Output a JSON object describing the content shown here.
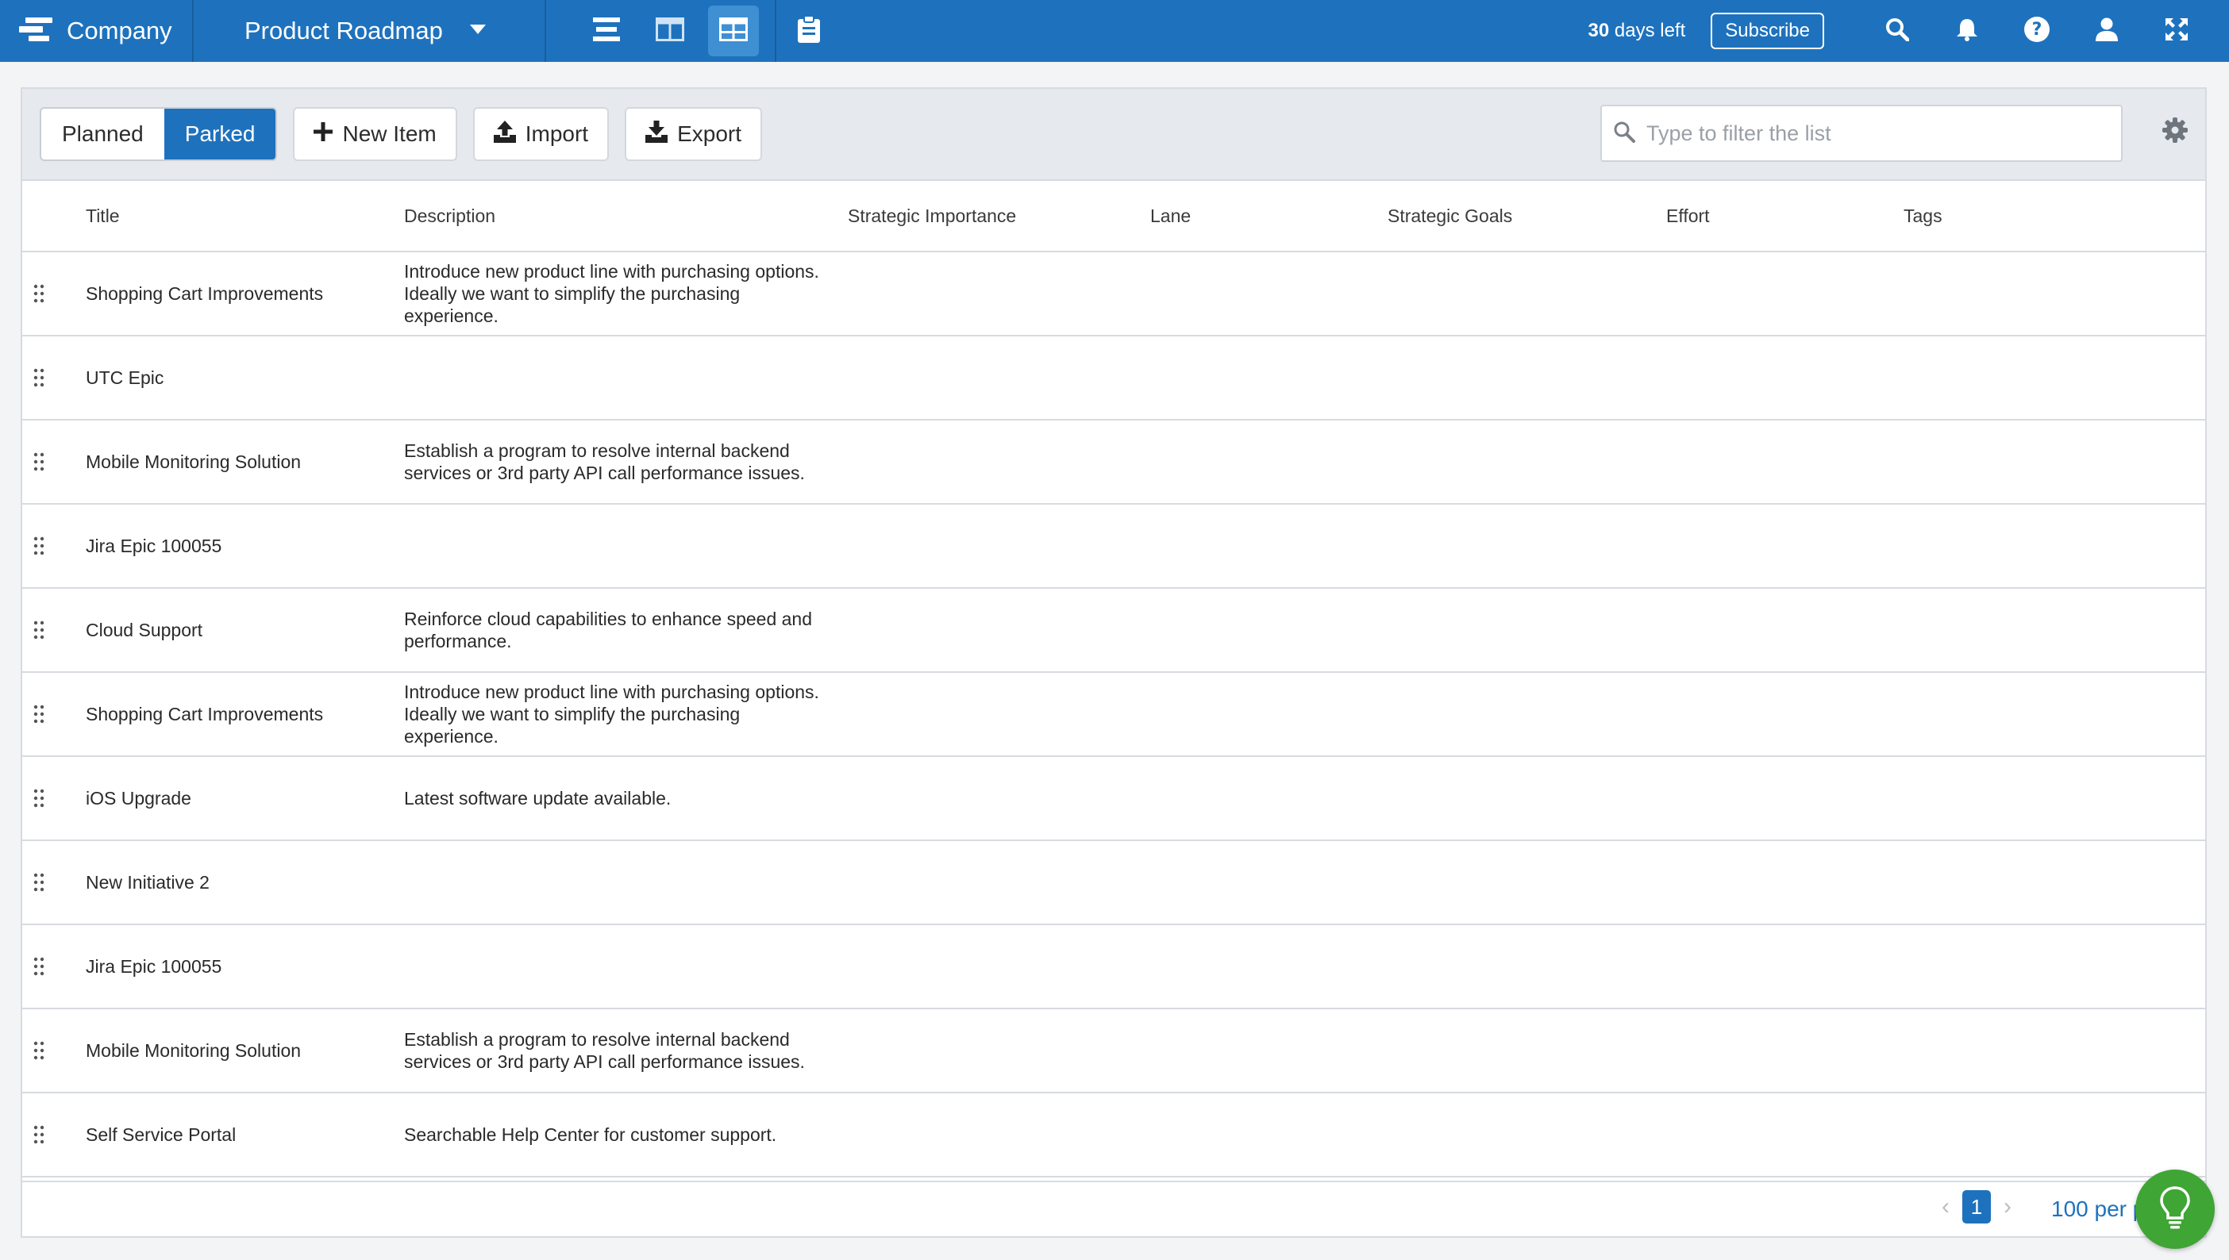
{
  "topbar": {
    "company": "Company",
    "roadmap": "Product Roadmap",
    "days_number": "30",
    "days_text": " days left",
    "subscribe": "Subscribe"
  },
  "toolbar": {
    "planned": "Planned",
    "parked": "Parked",
    "new_item": "New Item",
    "import": "Import",
    "export": "Export",
    "filter_placeholder": "Type to filter the list"
  },
  "table": {
    "headers": {
      "title": "Title",
      "description": "Description",
      "strategic_importance": "Strategic Importance",
      "lane": "Lane",
      "strategic_goals": "Strategic Goals",
      "effort": "Effort",
      "tags": "Tags"
    },
    "rows": [
      {
        "title": "Shopping Cart Improvements",
        "description": "Introduce new product line with purchasing options. Ideally we want to simplify the purchasing experience."
      },
      {
        "title": "UTC Epic",
        "description": ""
      },
      {
        "title": "Mobile Monitoring Solution",
        "description": "Establish a program to resolve internal backend services or 3rd party API call performance issues."
      },
      {
        "title": "Jira Epic 100055",
        "description": ""
      },
      {
        "title": "Cloud Support",
        "description": "Reinforce cloud capabilities to enhance speed and performance."
      },
      {
        "title": "Shopping Cart Improvements",
        "description": "Introduce new product line with purchasing options. Ideally we want to simplify the purchasing experience."
      },
      {
        "title": "iOS Upgrade",
        "description": "Latest software update available."
      },
      {
        "title": "New Initiative 2",
        "description": ""
      },
      {
        "title": "Jira Epic 100055",
        "description": ""
      },
      {
        "title": "Mobile Monitoring Solution",
        "description": "Establish a program to resolve internal backend services or 3rd party API call performance issues."
      },
      {
        "title": "Self Service Portal",
        "description": "Searchable Help Center for customer support."
      }
    ]
  },
  "pagination": {
    "current_page": "1",
    "per_page": "100 per pa"
  },
  "colors": {
    "brand": "#1e72bd",
    "help_button": "#3fa535"
  },
  "icons": {
    "logo": "company-logo-icon",
    "dropdown": "caret-down-icon",
    "views": [
      "list-view-icon",
      "columns-view-icon",
      "table-view-icon"
    ],
    "clipboard": "clipboard-icon",
    "topbar_actions": [
      "search-icon",
      "bell-icon",
      "help-icon",
      "user-icon",
      "expand-icon"
    ],
    "settings": "gear-icon",
    "help_bulb": "lightbulb-icon"
  }
}
